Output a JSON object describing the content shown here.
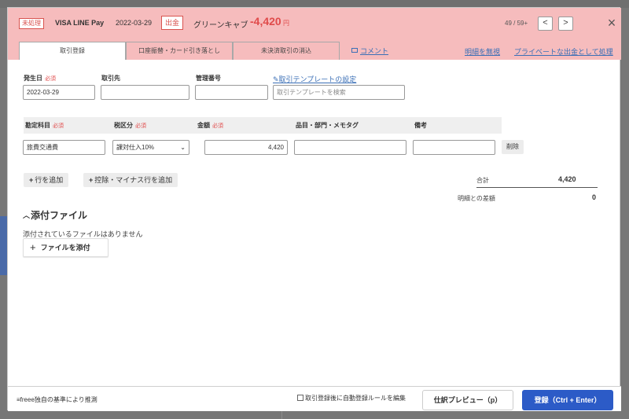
{
  "header": {
    "status": "未処理",
    "wallet": "VISA LINE Pay",
    "date": "2022-03-29",
    "type": "出金",
    "partner": "グリーンキャブ",
    "amount": "-4,420",
    "currency": "円",
    "pager": "49 / 59+",
    "prev": "<",
    "next": ">",
    "close": "×"
  },
  "tabs": [
    {
      "label": "取引登録"
    },
    {
      "label": "口座振替・カード引き落とし"
    },
    {
      "label": "未決済取引の消込"
    }
  ],
  "links": {
    "comment": "コメント",
    "ignore": "明細を無視",
    "private": "プライベートな出金として処理"
  },
  "form": {
    "required": "必須",
    "date_label": "発生日",
    "date_value": "2022-03-29",
    "partner_label": "取引先",
    "partner_value": "",
    "mgmt_label": "管理番号",
    "mgmt_value": "",
    "template_link": "取引テンプレートの設定",
    "template_placeholder": "取引テンプレートを検索"
  },
  "grid": {
    "headers": {
      "account": "勘定科目",
      "tax": "税区分",
      "amount": "金額",
      "item": "品目・部門・メモタグ",
      "note": "備考"
    },
    "row": {
      "account": "旅費交通費",
      "tax": "課対仕入10%",
      "amount": "4,420",
      "item": "",
      "note": "",
      "delete": "削除"
    }
  },
  "actions": {
    "add_row": "行を追加",
    "add_deduction": "控除・マイナス行を追加"
  },
  "totals": {
    "total_label": "合計",
    "total_value": "4,420",
    "diff_label": "明細との差額",
    "diff_value": "0"
  },
  "attachments": {
    "title": "添付ファイル",
    "empty": "添付されているファイルはありません",
    "attach_button": "ファイルを添付"
  },
  "footer": {
    "inference": "freee独自の基準により推測",
    "auto_rule": "取引登録後に自動登録ルールを編集",
    "preview": "仕訳プレビュー（p）",
    "submit": "登録（Ctrl + Enter）"
  },
  "colors": {
    "header_bg": "#f6bcbd",
    "amount_red": "#e04b4b",
    "link_blue": "#3b6fb6",
    "primary_blue": "#2c5bc7"
  }
}
